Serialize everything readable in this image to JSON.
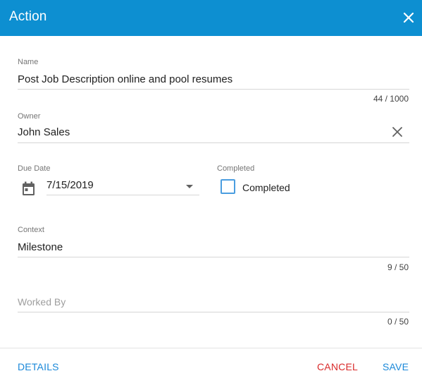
{
  "dialog": {
    "title": "Action",
    "close_icon": "close-icon"
  },
  "colors": {
    "header_bg": "#0d8fd1",
    "accent": "#1a88d9",
    "danger": "#d92b2b",
    "checkbox_border": "#4a9de0"
  },
  "fields": {
    "name": {
      "label": "Name",
      "value": "Post Job Description online and pool resumes",
      "counter": "44 / 1000"
    },
    "owner": {
      "label": "Owner",
      "value": "John Sales",
      "clear_icon": "close-icon"
    },
    "due_date": {
      "label": "Due Date",
      "value": "7/15/2019",
      "icon": "calendar-icon",
      "dropdown_icon": "chevron-down-icon"
    },
    "completed": {
      "label": "Completed",
      "checkbox_label": "Completed",
      "checked": false
    },
    "context": {
      "label": "Context",
      "value": "Milestone",
      "counter": "9 / 50"
    },
    "worked_by": {
      "placeholder": "Worked By",
      "value": "",
      "counter": "0 / 50"
    }
  },
  "footer": {
    "details_label": "DETAILS",
    "cancel_label": "CANCEL",
    "save_label": "SAVE"
  }
}
